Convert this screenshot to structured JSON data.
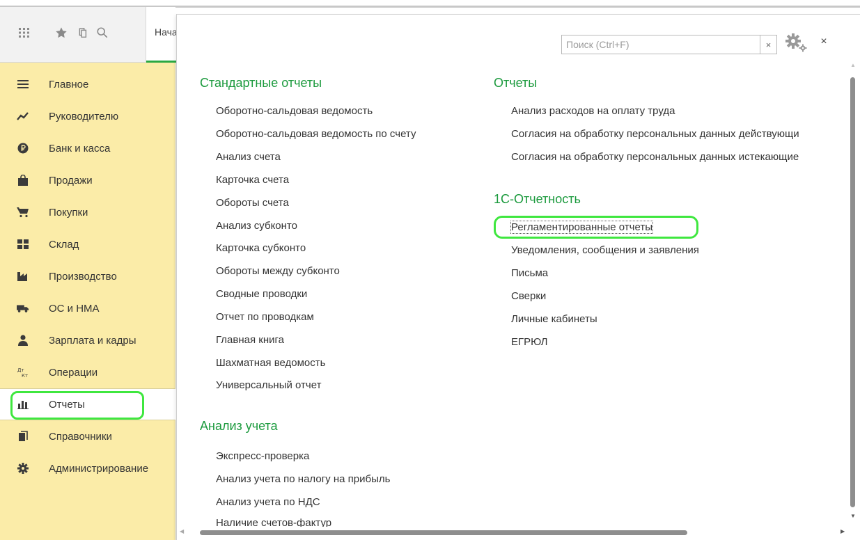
{
  "start_tab": {
    "label": "Начальная страница"
  },
  "nav": {
    "items": [
      {
        "label": "Главное",
        "icon": "menu-lines-icon"
      },
      {
        "label": "Руководителю",
        "icon": "trend-chart-icon"
      },
      {
        "label": "Банк и касса",
        "icon": "ruble-coin-icon"
      },
      {
        "label": "Продажи",
        "icon": "shopping-bag-icon"
      },
      {
        "label": "Покупки",
        "icon": "cart-icon"
      },
      {
        "label": "Склад",
        "icon": "warehouse-icon"
      },
      {
        "label": "Производство",
        "icon": "factory-icon"
      },
      {
        "label": "ОС и НМА",
        "icon": "truck-icon"
      },
      {
        "label": "Зарплата и кадры",
        "icon": "person-icon"
      },
      {
        "label": "Операции",
        "icon": "debit-credit-icon"
      },
      {
        "label": "Отчеты",
        "icon": "bar-chart-icon",
        "active": true
      },
      {
        "label": "Справочники",
        "icon": "books-icon"
      },
      {
        "label": "Администрирование",
        "icon": "gear-icon"
      }
    ]
  },
  "search": {
    "placeholder": "Поиск (Ctrl+F)",
    "clear": "×"
  },
  "close": "×",
  "sections": {
    "standard": {
      "title": "Стандартные отчеты",
      "links": [
        "Оборотно-сальдовая ведомость",
        "Оборотно-сальдовая ведомость по счету",
        "Анализ счета",
        "Карточка счета",
        "Обороты счета",
        "Анализ субконто",
        "Карточка субконто",
        "Обороты между субконто",
        "Сводные проводки",
        "Отчет по проводкам",
        "Главная книга",
        "Шахматная ведомость",
        "Универсальный отчет"
      ]
    },
    "analysis": {
      "title": "Анализ учета",
      "links": [
        "Экспресс-проверка",
        "Анализ учета по налогу на прибыль",
        "Анализ учета по НДС",
        "Наличие счетов-фактур"
      ]
    },
    "reports": {
      "title": "Отчеты",
      "links": [
        "Анализ расходов на оплату труда",
        "Согласия на обработку персональных данных действующи",
        "Согласия на обработку персональных данных истекающие"
      ]
    },
    "onec": {
      "title": "1С-Отчетность",
      "links": [
        "Регламентированные отчеты",
        "Уведомления, сообщения и заявления",
        "Письма",
        "Сверки",
        "Личные кабинеты",
        "ЕГРЮЛ"
      ]
    }
  },
  "colors": {
    "accent_green": "#1b9a3d",
    "highlight": "#3fe73f",
    "sidebar_bg": "#fbeca8"
  }
}
